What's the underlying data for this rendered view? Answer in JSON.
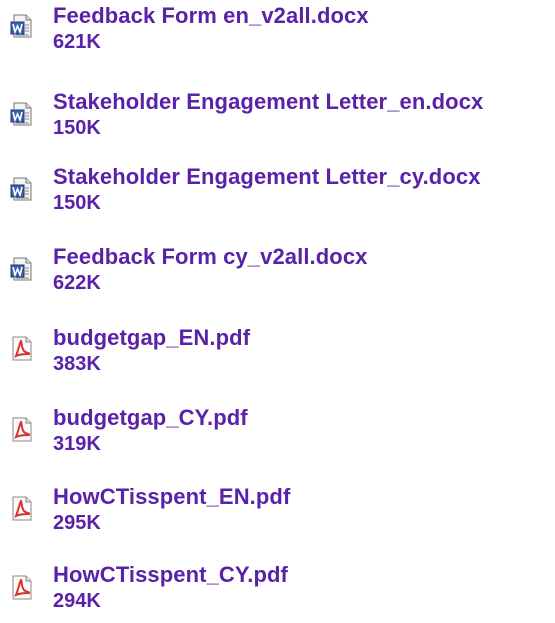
{
  "attachments": [
    {
      "name": "Feedback Form en_v2all.docx",
      "size": "621K",
      "icon": "word-document-icon"
    },
    {
      "name": "Stakeholder Engagement Letter_en.docx",
      "size": "150K",
      "icon": "word-document-icon"
    },
    {
      "name": "Stakeholder Engagement Letter_cy.docx",
      "size": "150K",
      "icon": "word-document-icon"
    },
    {
      "name": "Feedback Form cy_v2all.docx",
      "size": "622K",
      "icon": "word-document-icon"
    },
    {
      "name": "budgetgap_EN.pdf",
      "size": "383K",
      "icon": "pdf-document-icon"
    },
    {
      "name": "budgetgap_CY.pdf",
      "size": "319K",
      "icon": "pdf-document-icon"
    },
    {
      "name": "HowCTisspent_EN.pdf",
      "size": "295K",
      "icon": "pdf-document-icon"
    },
    {
      "name": "HowCTisspent_CY.pdf",
      "size": "294K",
      "icon": "pdf-document-icon"
    }
  ],
  "colors": {
    "link_text": "#5a22a8",
    "word_icon_blue": "#3a5fb0",
    "pdf_icon_red": "#d9322b"
  }
}
